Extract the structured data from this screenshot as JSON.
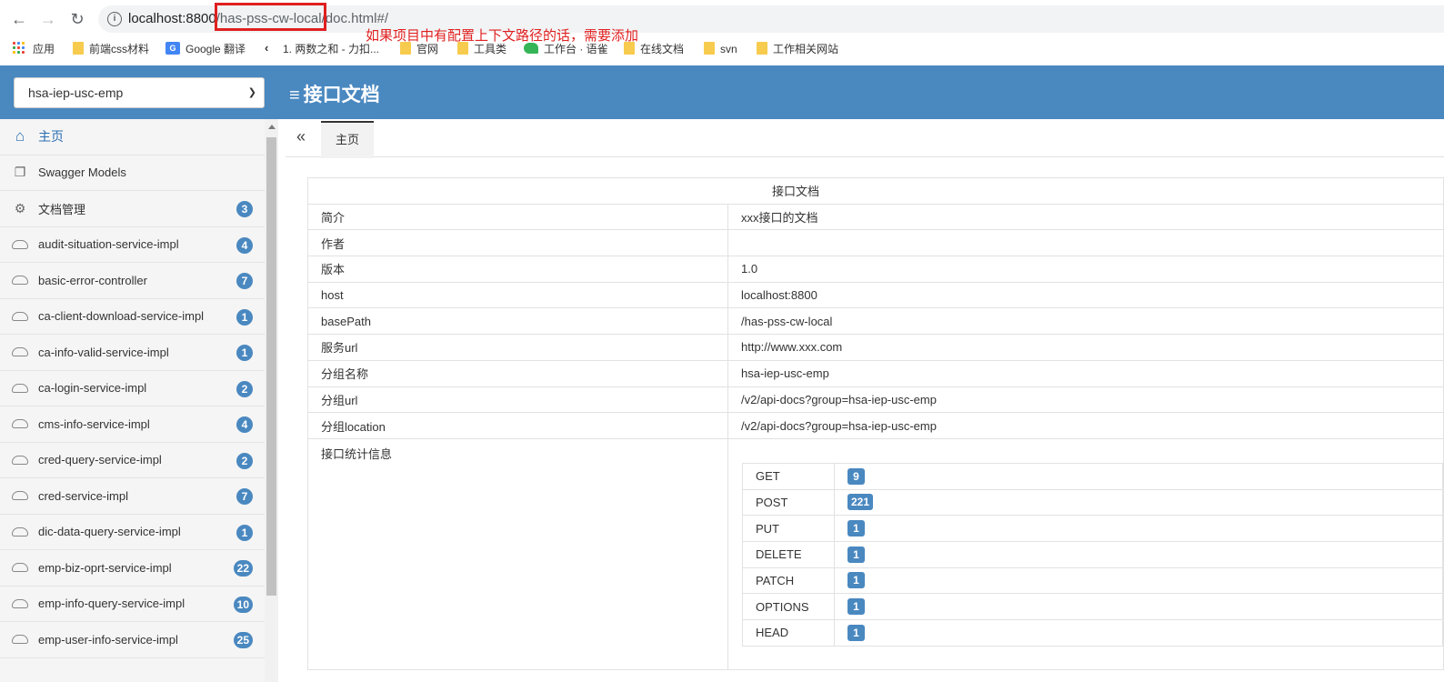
{
  "browser": {
    "url_host": "localhost:8800",
    "url_highlight": "/has-pss-cw-local/",
    "url_rest": "doc.html#/",
    "annotation": "如果项目中有配置上下文路径的话，需要添加",
    "bookmarks": [
      {
        "label": "应用",
        "icon": "apps-grid-icon"
      },
      {
        "label": "前端css材料",
        "icon": "folder-icon"
      },
      {
        "label": "Google 翻译",
        "icon": "google-translate-icon"
      },
      {
        "label": "1. 两数之和 - 力扣...",
        "icon": "leetcode-icon"
      },
      {
        "label": "官网",
        "icon": "folder-icon"
      },
      {
        "label": "工具类",
        "icon": "folder-icon"
      },
      {
        "label": "工作台 · 语雀",
        "icon": "yuque-icon"
      },
      {
        "label": "在线文档",
        "icon": "folder-icon"
      },
      {
        "label": "svn",
        "icon": "folder-icon"
      },
      {
        "label": "工作相关网站",
        "icon": "folder-icon"
      }
    ]
  },
  "header": {
    "group_selected": "hsa-iep-usc-emp",
    "title": "接口文档"
  },
  "sidebar": {
    "items": [
      {
        "label": "主页",
        "icon": "home-icon",
        "badge": ""
      },
      {
        "label": "Swagger Models",
        "icon": "cube-icon",
        "badge": ""
      },
      {
        "label": "文档管理",
        "icon": "document-gear-icon",
        "badge": "3"
      },
      {
        "label": "audit-situation-service-impl",
        "icon": "api-cloud-icon",
        "badge": "4"
      },
      {
        "label": "basic-error-controller",
        "icon": "api-cloud-icon",
        "badge": "7"
      },
      {
        "label": "ca-client-download-service-impl",
        "icon": "api-cloud-icon",
        "badge": "1"
      },
      {
        "label": "ca-info-valid-service-impl",
        "icon": "api-cloud-icon",
        "badge": "1"
      },
      {
        "label": "ca-login-service-impl",
        "icon": "api-cloud-icon",
        "badge": "2"
      },
      {
        "label": "cms-info-service-impl",
        "icon": "api-cloud-icon",
        "badge": "4"
      },
      {
        "label": "cred-query-service-impl",
        "icon": "api-cloud-icon",
        "badge": "2"
      },
      {
        "label": "cred-service-impl",
        "icon": "api-cloud-icon",
        "badge": "7"
      },
      {
        "label": "dic-data-query-service-impl",
        "icon": "api-cloud-icon",
        "badge": "1"
      },
      {
        "label": "emp-biz-oprt-service-impl",
        "icon": "api-cloud-icon",
        "badge": "22"
      },
      {
        "label": "emp-info-query-service-impl",
        "icon": "api-cloud-icon",
        "badge": "10"
      },
      {
        "label": "emp-user-info-service-impl",
        "icon": "api-cloud-icon",
        "badge": "25"
      }
    ]
  },
  "tabs": {
    "collapse_symbol": "«",
    "home_label": "主页"
  },
  "doc": {
    "title": "接口文档",
    "rows": [
      {
        "key": "简介",
        "value": "xxx接口的文档"
      },
      {
        "key": "作者",
        "value": ""
      },
      {
        "key": "版本",
        "value": "1.0"
      },
      {
        "key": "host",
        "value": "localhost:8800"
      },
      {
        "key": "basePath",
        "value": "/has-pss-cw-local"
      },
      {
        "key": "服务url",
        "value": "http://www.xxx.com"
      },
      {
        "key": "分组名称",
        "value": "hsa-iep-usc-emp"
      },
      {
        "key": "分组url",
        "value": "/v2/api-docs?group=hsa-iep-usc-emp"
      },
      {
        "key": "分组location",
        "value": "/v2/api-docs?group=hsa-iep-usc-emp"
      }
    ],
    "stats_label": "接口统计信息",
    "stats": [
      {
        "method": "GET",
        "count": "9"
      },
      {
        "method": "POST",
        "count": "221"
      },
      {
        "method": "PUT",
        "count": "1"
      },
      {
        "method": "DELETE",
        "count": "1"
      },
      {
        "method": "PATCH",
        "count": "1"
      },
      {
        "method": "OPTIONS",
        "count": "1"
      },
      {
        "method": "HEAD",
        "count": "1"
      }
    ]
  },
  "colors": {
    "header": "#4a88c0",
    "badge": "#4a88c0",
    "annotation": "#e02020"
  }
}
